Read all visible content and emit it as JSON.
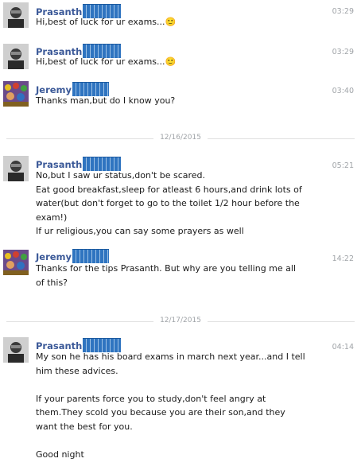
{
  "messages": [
    {
      "sender": "Prasanth",
      "time": "03:29",
      "text": "Hi,best of luck for ur exams...🙂"
    },
    {
      "sender": "Prasanth",
      "time": "03:29",
      "text": "Hi,best of luck for ur exams...🙂"
    },
    {
      "sender": "Jeremy",
      "time": "03:40",
      "text": "Thanks man,but do I know you?"
    },
    {
      "sender": "Prasanth",
      "time": "05:21",
      "text": "No,but I saw ur status,don't be scared.\nEat good breakfast,sleep for atleast 6 hours,and drink lots of water(but don't forget to go to the toilet 1/2 hour before the exam!)\nIf ur religious,you can say some prayers as well"
    },
    {
      "sender": "Jeremy",
      "time": "14:22",
      "text": "Thanks for the tips Prasanth. But why are you telling me all of this?"
    },
    {
      "sender": "Prasanth",
      "time": "04:14",
      "text": "My son he has his board exams in march next year...and I tell him these advices.\n\nIf your parents force you to study,don't feel angry at them.They scold you because you are their son,and they want the best for you.\n\nGood night"
    }
  ],
  "dividers": [
    "12/16/2015",
    "12/17/2015"
  ]
}
